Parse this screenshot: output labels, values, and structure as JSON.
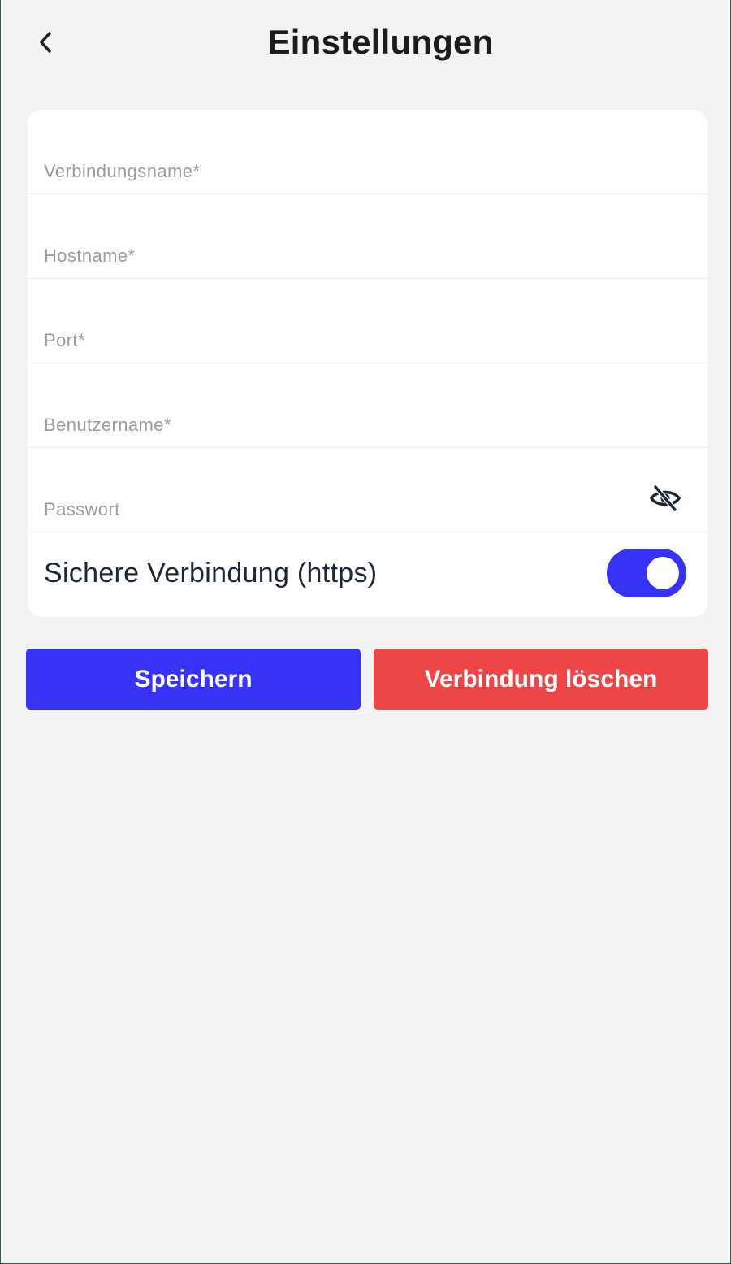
{
  "header": {
    "title": "Einstellungen",
    "back_icon": "chevron-left-icon"
  },
  "form": {
    "fields": [
      {
        "placeholder": "Verbindungsname*",
        "value": ""
      },
      {
        "placeholder": "Hostname*",
        "value": ""
      },
      {
        "placeholder": "Port*",
        "value": ""
      },
      {
        "placeholder": "Benutzername*",
        "value": ""
      },
      {
        "placeholder": "Passwort",
        "value": "",
        "visibility_icon": "eye-off-icon"
      }
    ],
    "https_toggle": {
      "label": "Sichere Verbindung (https)",
      "enabled": true
    }
  },
  "actions": {
    "save_label": "Speichern",
    "delete_label": "Verbindung löschen"
  },
  "colors": {
    "background": "#f3f3f3",
    "card": "#ffffff",
    "accent": "#3633f7",
    "danger": "#ee4646",
    "placeholder": "#9a9aa0",
    "text": "#1c1c1e"
  }
}
